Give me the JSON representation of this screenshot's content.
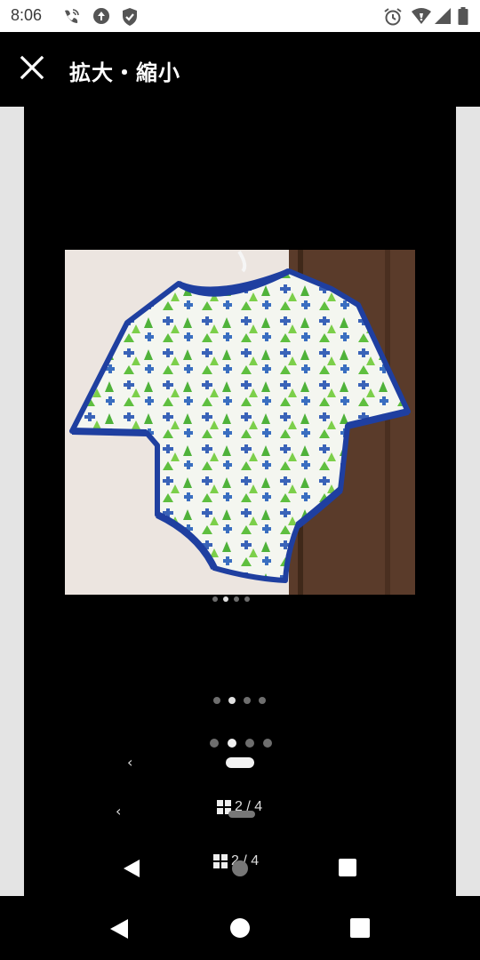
{
  "status_bar": {
    "time": "8:06",
    "left_icons": [
      "wifi-calling-icon",
      "data-saver-icon",
      "shield-check-icon"
    ],
    "right_icons": [
      "alarm-icon",
      "wifi-signal-icon",
      "cell-signal-icon",
      "battery-icon"
    ]
  },
  "app_bar": {
    "close_icon": "close-icon",
    "title": "拡大・縮小"
  },
  "viewer": {
    "image_description_icon": "baby-bodysuit-photo",
    "page_indicator": {
      "current": 2,
      "total": 4,
      "label_primary": "2 / 4",
      "label_secondary": "2 / 4"
    },
    "prev_chevron": "‹",
    "prev_chevron_lower": "‹"
  },
  "colors": {
    "background": "#000000",
    "side_gutter": "#e4e4e4",
    "status_bar": "#ffffff",
    "dot_active": "#e0e0e0",
    "dot_inactive": "#6e6e6e"
  },
  "system_nav": {
    "back_icon": "back-triangle-icon",
    "home_icon": "home-circle-icon",
    "recents_icon": "recents-square-icon"
  }
}
